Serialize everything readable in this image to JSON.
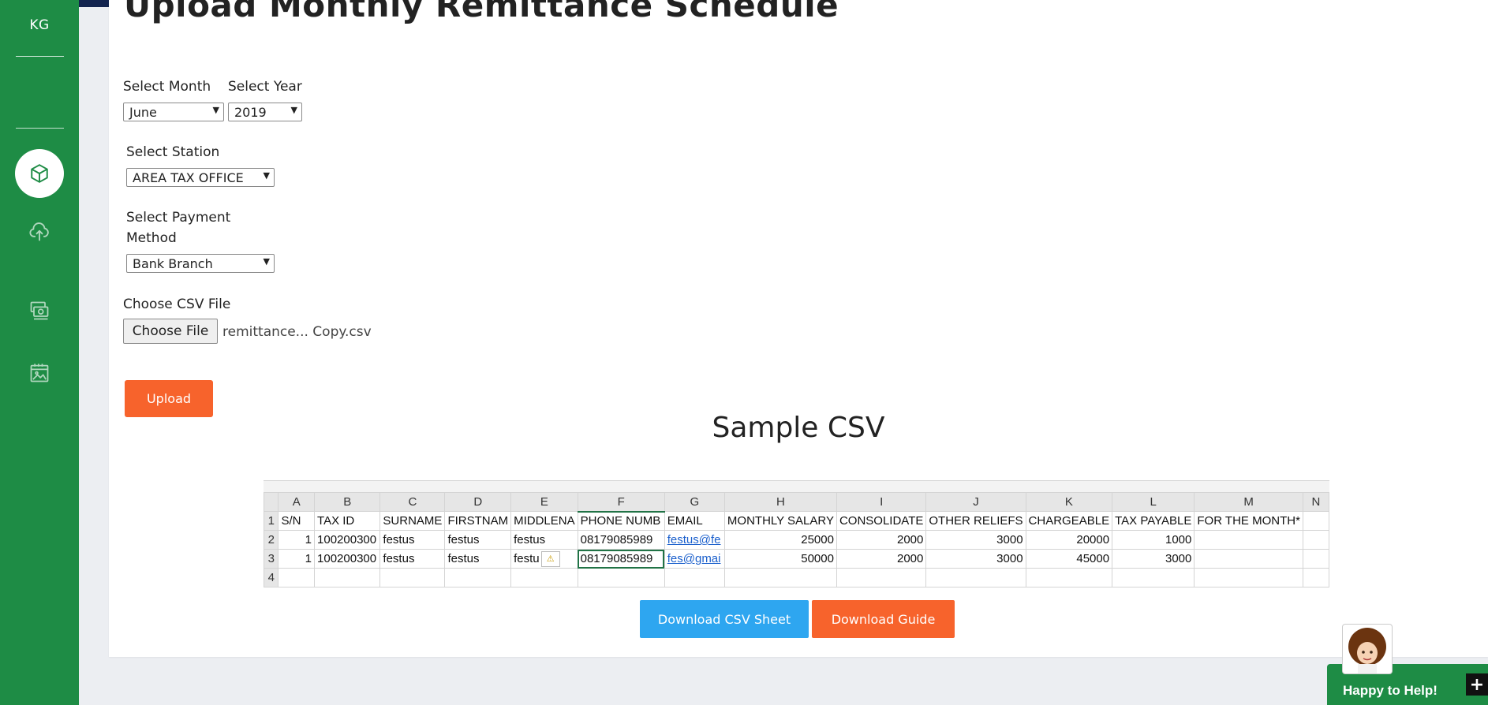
{
  "sidebar": {
    "initials": "KG",
    "items": [
      {
        "icon": "cube-icon",
        "active": true
      },
      {
        "icon": "cloud-upload-icon",
        "active": false
      },
      {
        "icon": "money-icon",
        "active": false
      },
      {
        "icon": "calendar-image-icon",
        "active": false
      }
    ]
  },
  "page": {
    "title": "Upload Monthly Remittance Schedule"
  },
  "form": {
    "month_label": "Select Month",
    "month_value": "June",
    "year_label": "Select Year",
    "year_value": "2019",
    "station_label": "Select Station",
    "station_value": "AREA TAX OFFICE",
    "payment_label_line1": "Select Payment",
    "payment_label_line2": "Method",
    "payment_value": "Bank Branch",
    "csv_label": "Choose CSV File",
    "choose_file_button": "Choose File",
    "file_name": "remittance... Copy.csv",
    "upload_button": "Upload"
  },
  "sample": {
    "title": "Sample CSV",
    "columns": [
      "A",
      "B",
      "C",
      "D",
      "E",
      "F",
      "G",
      "H",
      "I",
      "J",
      "K",
      "L",
      "M",
      "N"
    ],
    "rows": [
      {
        "num": "1",
        "cells": [
          "S/N",
          "TAX ID",
          "SURNAME",
          "FIRSTNAM",
          "MIDDLENA",
          "PHONE NUMB",
          "EMAIL",
          "MONTHLY SALARY",
          "CONSOLIDATE",
          "OTHER RELIEFS",
          "CHARGEABLE",
          "TAX PAYABLE",
          "FOR THE MONTH*",
          ""
        ]
      },
      {
        "num": "2",
        "cells": [
          "1",
          "100200300",
          "festus",
          "festus",
          "festus",
          "08179085989",
          "festus@fe",
          "25000",
          "2000",
          "3000",
          "20000",
          "1000",
          "",
          ""
        ]
      },
      {
        "num": "3",
        "cells": [
          "1",
          "100200300",
          "festus",
          "festus",
          "festu",
          "08179085989",
          "fes@gmai",
          "50000",
          "2000",
          "3000",
          "45000",
          "3000",
          "",
          ""
        ]
      },
      {
        "num": "4",
        "cells": [
          "",
          "",
          "",
          "",
          "",
          "",
          "",
          "",
          "",
          "",
          "",
          "",
          "",
          ""
        ]
      }
    ]
  },
  "buttons": {
    "download_csv": "Download CSV Sheet",
    "download_guide": "Download Guide"
  },
  "help": {
    "text": "Happy to Help!",
    "plus": "+"
  }
}
